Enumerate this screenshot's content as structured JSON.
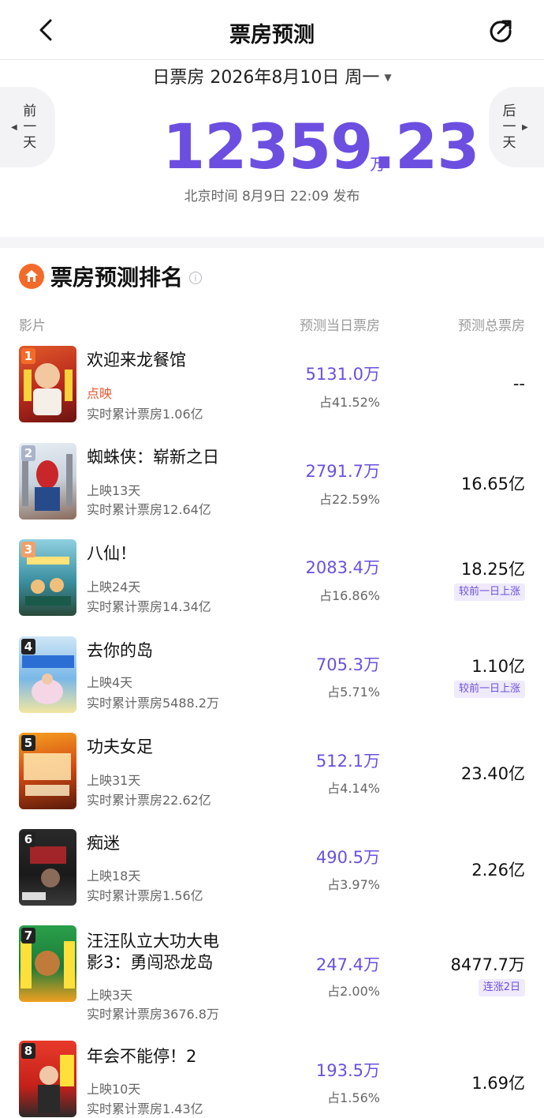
{
  "nav": {
    "title": "票房预测"
  },
  "hero": {
    "date_label": "日票房 2026年8月10日 周一",
    "prev_label": "前一天",
    "next_label": "后一天",
    "total": "12359.23",
    "unit": "万",
    "publish_time": "北京时间 8月9日 22:09 发布"
  },
  "section": {
    "title": "票房预测排名",
    "col_film": "影片",
    "col_day": "预测当日票房",
    "col_total": "预测总票房"
  },
  "movies": [
    {
      "rank": "1",
      "name": "欢迎来龙餐馆",
      "status": "点映",
      "cumulative": "实时累计票房1.06亿",
      "day_bo": "5131.0万",
      "share": "占41.52%",
      "total": "--",
      "tag": "",
      "rank_color": "#f36b2a"
    },
    {
      "rank": "2",
      "name": "蜘蛛侠：崭新之日",
      "status": "上映13天",
      "cumulative": "实时累计票房12.64亿",
      "day_bo": "2791.7万",
      "share": "占22.59%",
      "total": "16.65亿",
      "tag": "",
      "rank_color": "#a9b3c9"
    },
    {
      "rank": "3",
      "name": "八仙！",
      "status": "上映24天",
      "cumulative": "实时累计票房14.34亿",
      "day_bo": "2083.4万",
      "share": "占16.86%",
      "total": "18.25亿",
      "tag": "较前一日上涨",
      "rank_color": "#f0a06a"
    },
    {
      "rank": "4",
      "name": "去你的岛",
      "status": "上映4天",
      "cumulative": "实时累计票房5488.2万",
      "day_bo": "705.3万",
      "share": "占5.71%",
      "total": "1.10亿",
      "tag": "较前一日上涨",
      "rank_color": "#222222"
    },
    {
      "rank": "5",
      "name": "功夫女足",
      "status": "上映31天",
      "cumulative": "实时累计票房22.62亿",
      "day_bo": "512.1万",
      "share": "占4.14%",
      "total": "23.40亿",
      "tag": "",
      "rank_color": "#222222"
    },
    {
      "rank": "6",
      "name": "痴迷",
      "status": "上映18天",
      "cumulative": "实时累计票房1.56亿",
      "day_bo": "490.5万",
      "share": "占3.97%",
      "total": "2.26亿",
      "tag": "",
      "rank_color": "#222222"
    },
    {
      "rank": "7",
      "name_line1": "汪汪队立大功大电",
      "name_line2": "影3：勇闯恐龙岛",
      "status": "上映3天",
      "cumulative": "实时累计票房3676.8万",
      "day_bo": "247.4万",
      "share": "占2.00%",
      "total": "8477.7万",
      "tag": "连涨2日",
      "rank_color": "#222222"
    },
    {
      "rank": "8",
      "name": "年会不能停！2",
      "status": "上映10天",
      "cumulative": "实时累计票房1.43亿",
      "day_bo": "193.5万",
      "share": "占1.56%",
      "total": "1.69亿",
      "tag": "",
      "rank_color": "#222222"
    }
  ]
}
